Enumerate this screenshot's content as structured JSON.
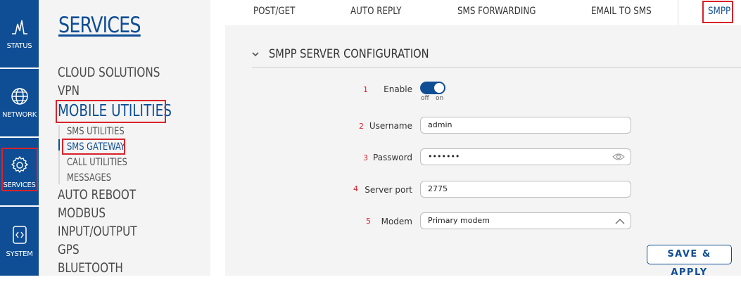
{
  "rail": {
    "items": [
      {
        "label": "STATUS",
        "icon": "status-icon"
      },
      {
        "label": "NETWORK",
        "icon": "globe-icon"
      },
      {
        "label": "SERVICES",
        "icon": "gear-icon"
      },
      {
        "label": "SYSTEM",
        "icon": "code-icon"
      }
    ]
  },
  "menu": {
    "title": "SERVICES",
    "items": {
      "cloud": "CLOUD SOLUTIONS",
      "vpn": "VPN",
      "mobile": "MOBILE UTILITIES",
      "sms_utilities": "SMS UTILITIES",
      "sms_gateway": "SMS GATEWAY",
      "call_utilities": "CALL UTILITIES",
      "messages": "MESSAGES",
      "auto_reboot": "AUTO REBOOT",
      "modbus": "MODBUS",
      "io": "INPUT/OUTPUT",
      "gps": "GPS",
      "bluetooth": "BLUETOOTH"
    }
  },
  "tabs": {
    "post_get": "POST/GET",
    "auto_reply": "AUTO REPLY",
    "sms_forwarding": "SMS FORWARDING",
    "email_to_sms": "EMAIL TO SMS",
    "smpp": "SMPP"
  },
  "section": {
    "title": "SMPP SERVER CONFIGURATION"
  },
  "form": {
    "enable": {
      "num": "1",
      "label": "Enable",
      "off": "off",
      "on": "on"
    },
    "username": {
      "num": "2",
      "label": "Username",
      "value": "admin"
    },
    "password": {
      "num": "3",
      "label": "Password",
      "value": "•••••••"
    },
    "port": {
      "num": "4",
      "label": "Server port",
      "value": "2775"
    },
    "modem": {
      "num": "5",
      "label": "Modem",
      "value": "Primary modem"
    }
  },
  "actions": {
    "save": "SAVE & APPLY"
  },
  "colors": {
    "brand": "#0f4e95",
    "highlight": "#d8232a"
  }
}
